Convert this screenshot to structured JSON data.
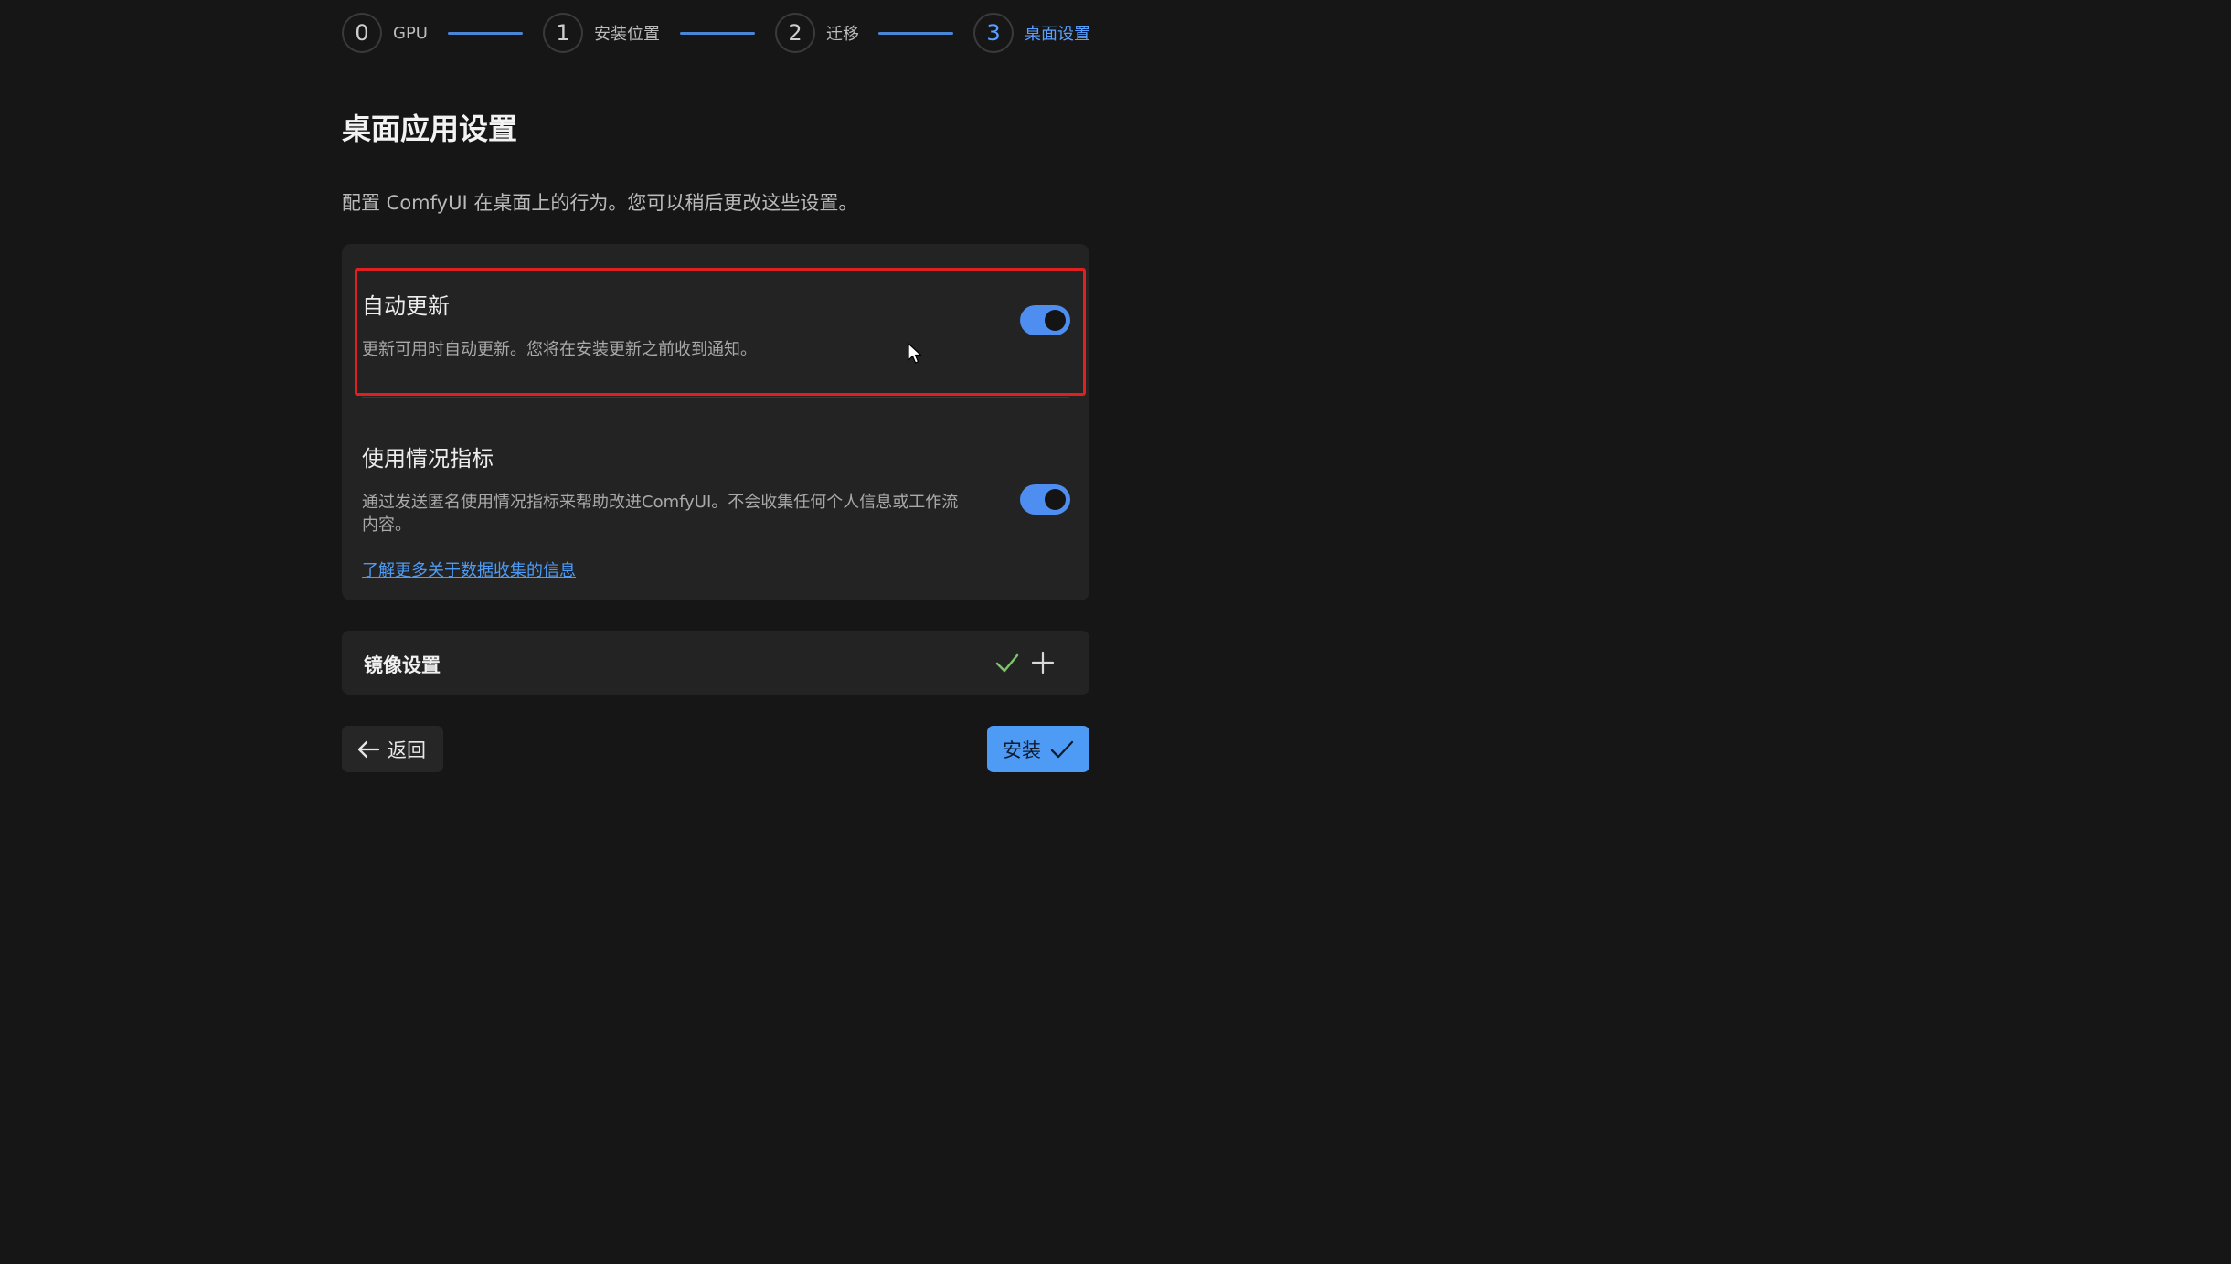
{
  "stepper": {
    "steps": [
      {
        "number": "0",
        "label": "GPU"
      },
      {
        "number": "1",
        "label": "安装位置"
      },
      {
        "number": "2",
        "label": "迁移"
      },
      {
        "number": "3",
        "label": "桌面设置"
      }
    ],
    "active_index": 3
  },
  "page": {
    "title": "桌面应用设置",
    "subtitle": "配置 ComfyUI 在桌面上的行为。您可以稍后更改这些设置。"
  },
  "settings": {
    "auto_update": {
      "title": "自动更新",
      "description": "更新可用时自动更新。您将在安装更新之前收到通知。",
      "enabled": true
    },
    "usage_metrics": {
      "title": "使用情况指标",
      "description_line1": "通过发送匿名使用情况指标来帮助改进ComfyUI。不会收集任何个人信息或工作流",
      "description_line2": "内容。",
      "enabled": true,
      "link_label": "了解更多关于数据收集的信息"
    }
  },
  "mirror": {
    "title": "镜像设置"
  },
  "footer": {
    "back_label": "返回",
    "install_label": "安装"
  },
  "colors": {
    "accent": "#4d9bf5",
    "highlight_border": "#e02020",
    "check_green": "#7ec36a"
  }
}
